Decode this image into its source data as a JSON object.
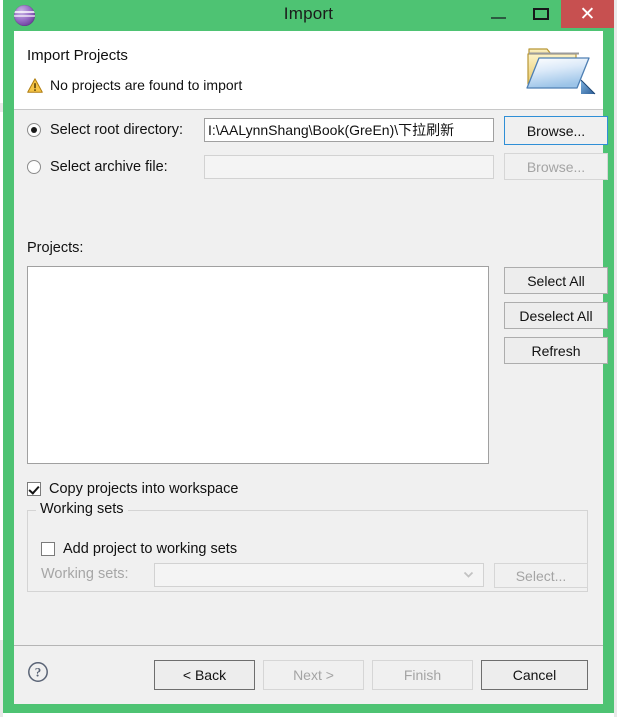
{
  "window": {
    "title": "Import",
    "app_icon": "eclipse-sphere-icon",
    "controls": {
      "minimize": "minimize-icon",
      "maximize": "maximize-icon",
      "close": "✕"
    },
    "colors": {
      "title_bar": "#4ec373",
      "close_button": "#c75050",
      "client_background": "#f0f0f0",
      "focus_accent": "#2f8fd6",
      "warning": "#f0a30a"
    }
  },
  "header": {
    "title": "Import Projects",
    "message": "No projects are found to import",
    "message_icon": "warning-triangle-icon",
    "banner_icon": "open-folder-icon"
  },
  "source": {
    "root_directory": {
      "label": "Select root directory:",
      "value": "I:\\AALynnShang\\Book(GreEn)\\下拉刷新",
      "selected": true,
      "browse_label": "Browse..."
    },
    "archive_file": {
      "label": "Select archive file:",
      "value": "",
      "placeholder": "",
      "selected": false,
      "browse_label": "Browse...",
      "enabled": false
    }
  },
  "projects": {
    "label": "Projects:",
    "items": [],
    "buttons": {
      "select_all": "Select All",
      "deselect_all": "Deselect All",
      "refresh": "Refresh"
    }
  },
  "options": {
    "copy_into_workspace": {
      "label": "Copy projects into workspace",
      "checked": true
    }
  },
  "working_sets": {
    "group_label": "Working sets",
    "add_to_working_sets": {
      "label": "Add project to working sets",
      "checked": false
    },
    "combo_label": "Working sets:",
    "combo_value": "",
    "combo_enabled": false,
    "select_label": "Select...",
    "select_enabled": false
  },
  "footer": {
    "help_icon": "help-question-icon",
    "buttons": [
      {
        "label": "< Back",
        "enabled": true,
        "name": "back-button"
      },
      {
        "label": "Next >",
        "enabled": false,
        "name": "next-button"
      },
      {
        "label": "Finish",
        "enabled": false,
        "name": "finish-button"
      },
      {
        "label": "Cancel",
        "enabled": true,
        "name": "cancel-button"
      }
    ]
  }
}
